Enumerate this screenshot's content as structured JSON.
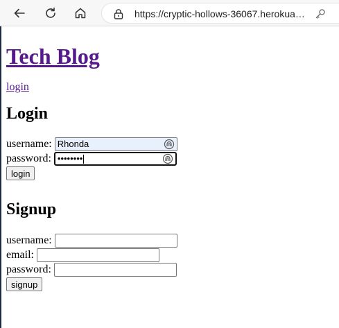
{
  "browser": {
    "url": "https://cryptic-hollows-36067.herokuapp.com/login",
    "icons": {
      "back": "back-arrow-icon",
      "reload": "reload-icon",
      "home": "home-icon",
      "lock": "lock-icon",
      "key": "key-icon"
    }
  },
  "header": {
    "title": "Tech Blog",
    "nav_link": "login"
  },
  "login": {
    "heading": "Login",
    "username_label": "username:",
    "username_value": "Rhonda",
    "password_label": "password:",
    "password_value": "••••••••",
    "submit_label": "login"
  },
  "signup": {
    "heading": "Signup",
    "username_label": "username:",
    "email_label": "email:",
    "password_label": "password:",
    "submit_label": "signup"
  },
  "colors": {
    "visited_link": "#551a8b",
    "autofill_background": "#e8f0fe"
  }
}
